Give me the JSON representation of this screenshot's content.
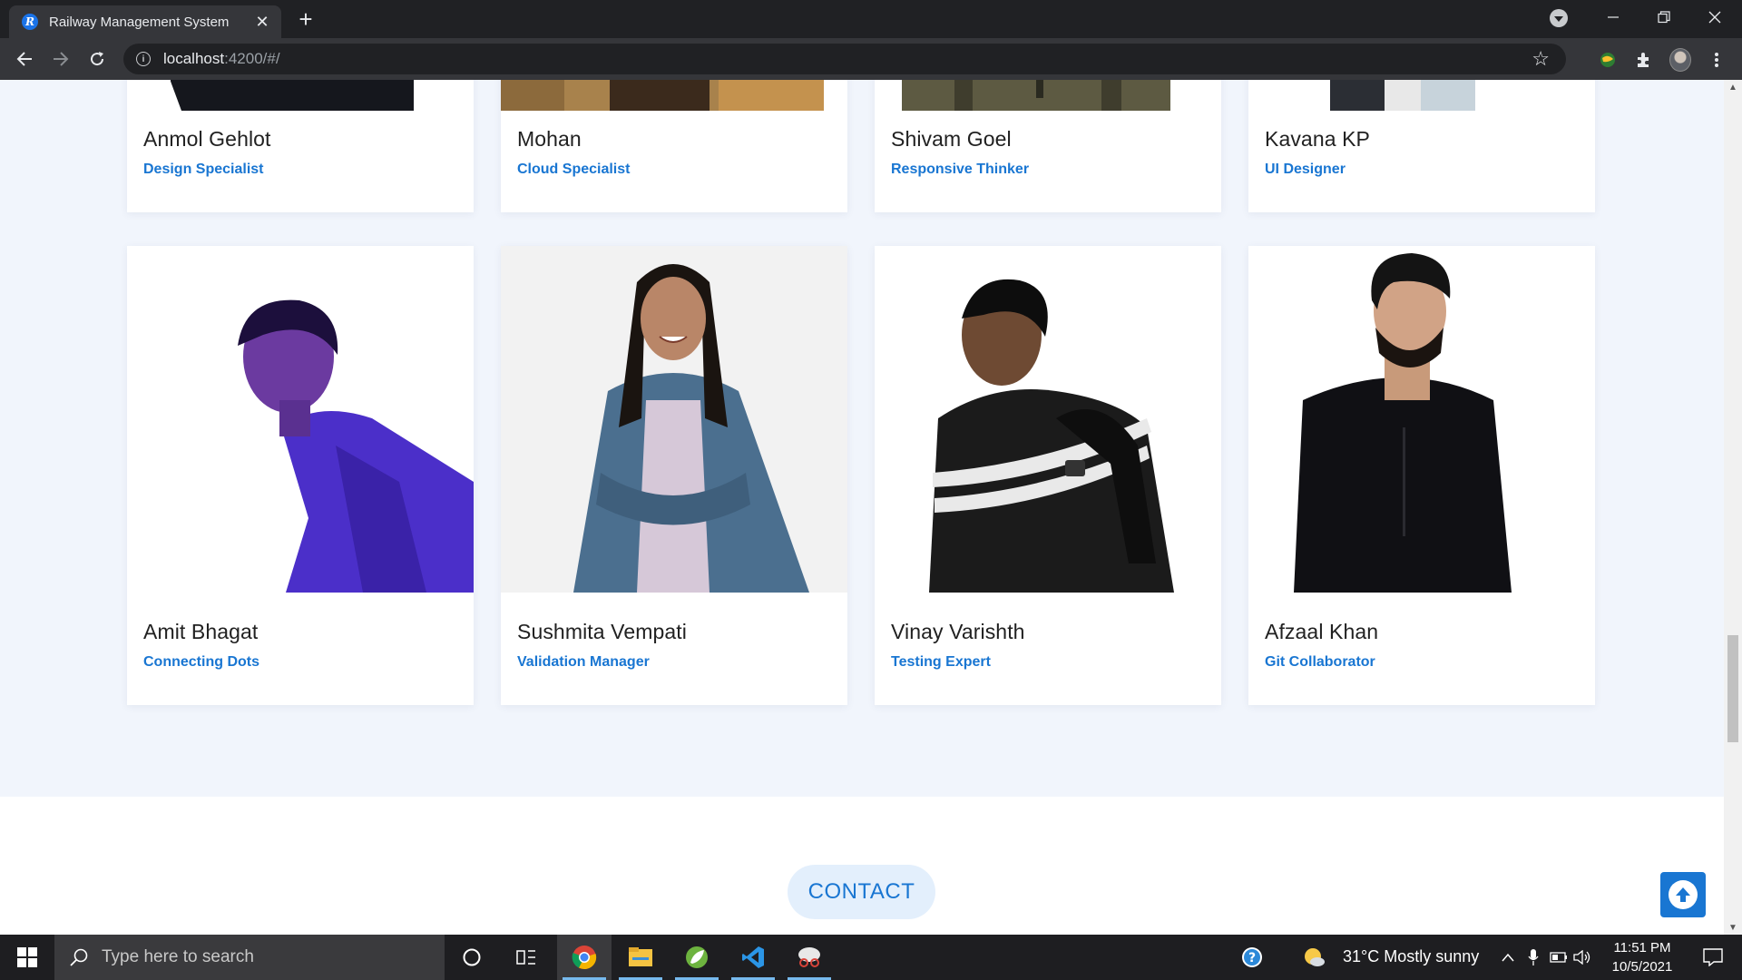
{
  "browser": {
    "tab_title": "Railway Management System",
    "tab_favicon": "R",
    "new_tab_label": "+",
    "url_host": "localhost",
    "url_path": ":4200/#/"
  },
  "team": {
    "top_row": [
      {
        "name": "Anmol Gehlot",
        "role": "Design Specialist"
      },
      {
        "name": "Mohan",
        "role": "Cloud Specialist"
      },
      {
        "name": "Shivam Goel",
        "role": "Responsive Thinker"
      },
      {
        "name": "Kavana KP",
        "role": "UI Designer"
      }
    ],
    "bottom_row": [
      {
        "name": "Amit Bhagat",
        "role": "Connecting Dots"
      },
      {
        "name": "Sushmita Vempati",
        "role": "Validation Manager"
      },
      {
        "name": "Vinay Varishth",
        "role": "Testing Expert"
      },
      {
        "name": "Afzaal Khan",
        "role": "Git Collaborator"
      }
    ]
  },
  "contact": {
    "label": "CONTACT"
  },
  "taskbar": {
    "search_placeholder": "Type here to search",
    "weather": "31°C  Mostly sunny",
    "time": "11:51 PM",
    "date": "10/5/2021"
  },
  "colors": {
    "accent": "#1976d2",
    "section_bg": "#f1f5fc",
    "chrome_dark": "#202124",
    "chrome_toolbar": "#35363a"
  }
}
